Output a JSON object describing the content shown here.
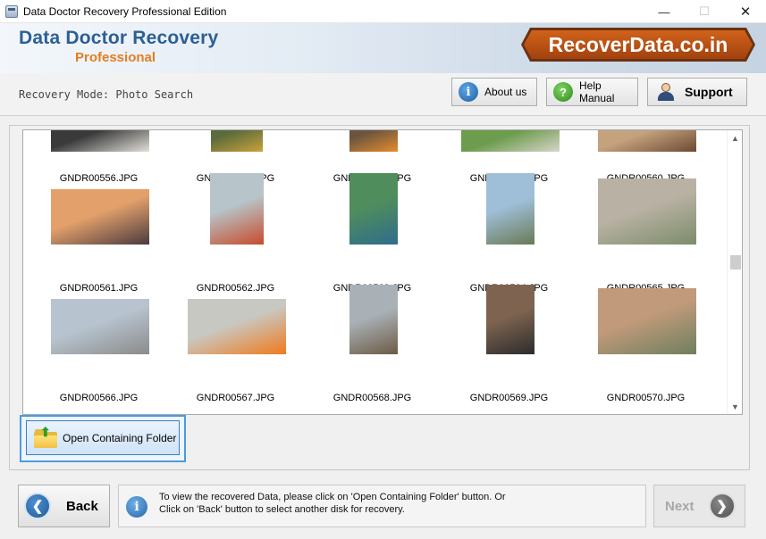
{
  "window": {
    "title": "Data Doctor Recovery Professional Edition",
    "controls": {
      "minimize": "—",
      "maximize": "☐",
      "close": "✕"
    }
  },
  "header": {
    "brand_main": "Data Doctor Recovery",
    "brand_sub": "Professional",
    "logo_text": "RecoverData.co.in",
    "logo_color": "#c0561a",
    "brand_color": "#2c5f95",
    "sub_color": "#e57d1f"
  },
  "toolbar": {
    "mode_label": "Recovery Mode: Photo Search",
    "about_label": "About us",
    "about_icon": "info-icon",
    "help_label": "Help Manual",
    "help_icon": "help-icon",
    "support_label": "Support",
    "support_icon": "support-person-icon"
  },
  "gallery": {
    "items": [
      {
        "name": "GNDR00556.JPG",
        "colors": [
          "#3a3a3a",
          "#e2dfd9"
        ]
      },
      {
        "name": "GNDR00557.JPG",
        "colors": [
          "#5c6b3c",
          "#c9a23b"
        ]
      },
      {
        "name": "GNDR00558.JPG",
        "colors": [
          "#6b5440",
          "#e58c2d"
        ]
      },
      {
        "name": "GNDR00559.JPG",
        "colors": [
          "#6c9c4d",
          "#d8d4c9"
        ]
      },
      {
        "name": "GNDR00560.JPG",
        "colors": [
          "#c4a27d",
          "#6b4a32"
        ]
      },
      {
        "name": "GNDR00561.JPG",
        "colors": [
          "#e3a06b",
          "#4b3a3e"
        ]
      },
      {
        "name": "GNDR00562.JPG",
        "colors": [
          "#b7c4c9",
          "#c74b2b"
        ]
      },
      {
        "name": "GNDR00563.JPG",
        "colors": [
          "#4f8d5c",
          "#2f6c8c"
        ]
      },
      {
        "name": "GNDR00564.JPG",
        "colors": [
          "#9fbfd9",
          "#6a7a55"
        ]
      },
      {
        "name": "GNDR00565.JPG",
        "colors": [
          "#b9b2a4",
          "#7d8c6a"
        ]
      },
      {
        "name": "GNDR00566.JPG",
        "colors": [
          "#b7c3ce",
          "#8b8b8b"
        ]
      },
      {
        "name": "GNDR00567.JPG",
        "colors": [
          "#c8c8c2",
          "#f07a1c"
        ]
      },
      {
        "name": "GNDR00568.JPG",
        "colors": [
          "#a9b1b7",
          "#6d5a44"
        ]
      },
      {
        "name": "GNDR00569.JPG",
        "colors": [
          "#7e6450",
          "#2c2c2c"
        ]
      },
      {
        "name": "GNDR00570.JPG",
        "colors": [
          "#c09a7a",
          "#6f7f5e"
        ]
      }
    ],
    "scroll_up_icon": "▲",
    "scroll_down_icon": "▼"
  },
  "actions": {
    "open_folder_label": "Open Containing Folder",
    "open_folder_icon": "folder-open-icon"
  },
  "footer": {
    "back_label": "Back",
    "back_icon": "arrow-left-icon",
    "info_icon": "info-icon",
    "info_line1": "To view the recovered Data, please click on 'Open Containing Folder' button. Or",
    "info_line2": "Click on 'Back' button to select another disk for recovery.",
    "next_label": "Next",
    "next_icon": "arrow-right-icon",
    "next_enabled": false
  }
}
